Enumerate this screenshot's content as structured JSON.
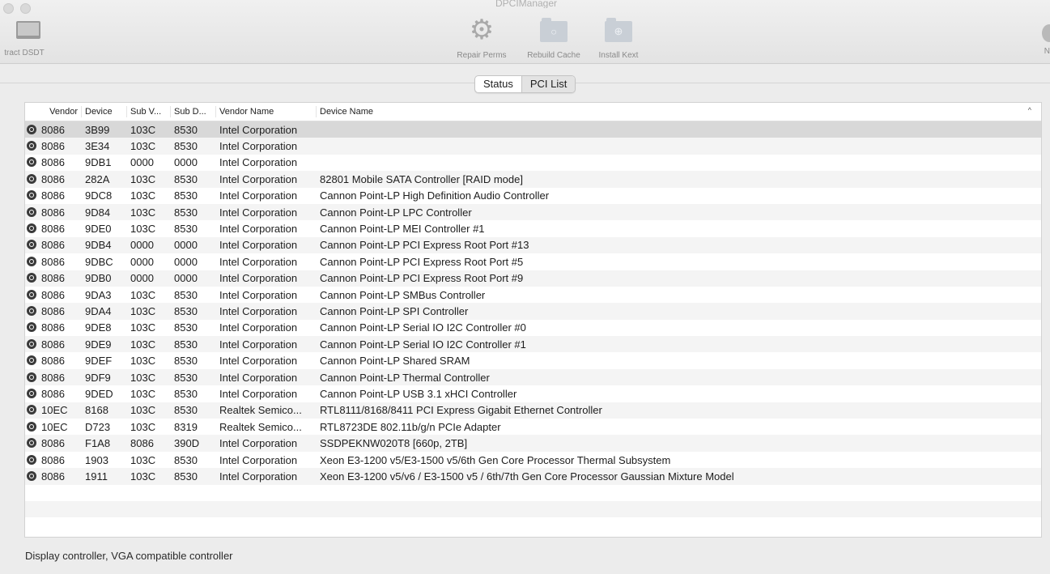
{
  "window": {
    "title": "DPCIManager"
  },
  "toolbar": {
    "extract_label": "tract DSDT",
    "repair_label": "Repair Perms",
    "rebuild_label": "Rebuild Cache",
    "install_label": "Install Kext",
    "edge_label": "N"
  },
  "tabs": {
    "status": "Status",
    "pci_list": "PCI List",
    "active": "PCI List"
  },
  "table": {
    "headers": {
      "vendor": "Vendor",
      "device": "Device",
      "sub_vendor": "Sub V...",
      "sub_device": "Sub D...",
      "vendor_name": "Vendor Name",
      "device_name": "Device Name"
    },
    "sort_indicator": "^",
    "selected_row": 0,
    "rows": [
      {
        "vendor": "8086",
        "device": "3B99",
        "sub_vendor": "103C",
        "sub_device": "8530",
        "vendor_name": "Intel Corporation",
        "device_name": ""
      },
      {
        "vendor": "8086",
        "device": "3E34",
        "sub_vendor": "103C",
        "sub_device": "8530",
        "vendor_name": "Intel Corporation",
        "device_name": ""
      },
      {
        "vendor": "8086",
        "device": "9DB1",
        "sub_vendor": "0000",
        "sub_device": "0000",
        "vendor_name": "Intel Corporation",
        "device_name": ""
      },
      {
        "vendor": "8086",
        "device": "282A",
        "sub_vendor": "103C",
        "sub_device": "8530",
        "vendor_name": "Intel Corporation",
        "device_name": "82801 Mobile SATA Controller [RAID mode]"
      },
      {
        "vendor": "8086",
        "device": "9DC8",
        "sub_vendor": "103C",
        "sub_device": "8530",
        "vendor_name": "Intel Corporation",
        "device_name": "Cannon Point-LP High Definition Audio Controller"
      },
      {
        "vendor": "8086",
        "device": "9D84",
        "sub_vendor": "103C",
        "sub_device": "8530",
        "vendor_name": "Intel Corporation",
        "device_name": "Cannon Point-LP LPC Controller"
      },
      {
        "vendor": "8086",
        "device": "9DE0",
        "sub_vendor": "103C",
        "sub_device": "8530",
        "vendor_name": "Intel Corporation",
        "device_name": "Cannon Point-LP MEI Controller #1"
      },
      {
        "vendor": "8086",
        "device": "9DB4",
        "sub_vendor": "0000",
        "sub_device": "0000",
        "vendor_name": "Intel Corporation",
        "device_name": "Cannon Point-LP PCI Express Root Port #13"
      },
      {
        "vendor": "8086",
        "device": "9DBC",
        "sub_vendor": "0000",
        "sub_device": "0000",
        "vendor_name": "Intel Corporation",
        "device_name": "Cannon Point-LP PCI Express Root Port #5"
      },
      {
        "vendor": "8086",
        "device": "9DB0",
        "sub_vendor": "0000",
        "sub_device": "0000",
        "vendor_name": "Intel Corporation",
        "device_name": "Cannon Point-LP PCI Express Root Port #9"
      },
      {
        "vendor": "8086",
        "device": "9DA3",
        "sub_vendor": "103C",
        "sub_device": "8530",
        "vendor_name": "Intel Corporation",
        "device_name": "Cannon Point-LP SMBus Controller"
      },
      {
        "vendor": "8086",
        "device": "9DA4",
        "sub_vendor": "103C",
        "sub_device": "8530",
        "vendor_name": "Intel Corporation",
        "device_name": "Cannon Point-LP SPI Controller"
      },
      {
        "vendor": "8086",
        "device": "9DE8",
        "sub_vendor": "103C",
        "sub_device": "8530",
        "vendor_name": "Intel Corporation",
        "device_name": "Cannon Point-LP Serial IO I2C Controller #0"
      },
      {
        "vendor": "8086",
        "device": "9DE9",
        "sub_vendor": "103C",
        "sub_device": "8530",
        "vendor_name": "Intel Corporation",
        "device_name": "Cannon Point-LP Serial IO I2C Controller #1"
      },
      {
        "vendor": "8086",
        "device": "9DEF",
        "sub_vendor": "103C",
        "sub_device": "8530",
        "vendor_name": "Intel Corporation",
        "device_name": "Cannon Point-LP Shared SRAM"
      },
      {
        "vendor": "8086",
        "device": "9DF9",
        "sub_vendor": "103C",
        "sub_device": "8530",
        "vendor_name": "Intel Corporation",
        "device_name": "Cannon Point-LP Thermal Controller"
      },
      {
        "vendor": "8086",
        "device": "9DED",
        "sub_vendor": "103C",
        "sub_device": "8530",
        "vendor_name": "Intel Corporation",
        "device_name": "Cannon Point-LP USB 3.1 xHCI Controller"
      },
      {
        "vendor": "10EC",
        "device": "8168",
        "sub_vendor": "103C",
        "sub_device": "8530",
        "vendor_name": "Realtek Semico...",
        "device_name": "RTL8111/8168/8411 PCI Express Gigabit Ethernet Controller"
      },
      {
        "vendor": "10EC",
        "device": "D723",
        "sub_vendor": "103C",
        "sub_device": "8319",
        "vendor_name": "Realtek Semico...",
        "device_name": "RTL8723DE 802.11b/g/n PCIe Adapter"
      },
      {
        "vendor": "8086",
        "device": "F1A8",
        "sub_vendor": "8086",
        "sub_device": "390D",
        "vendor_name": "Intel Corporation",
        "device_name": "SSDPEKNW020T8 [660p, 2TB]"
      },
      {
        "vendor": "8086",
        "device": "1903",
        "sub_vendor": "103C",
        "sub_device": "8530",
        "vendor_name": "Intel Corporation",
        "device_name": "Xeon E3-1200 v5/E3-1500 v5/6th Gen Core Processor Thermal Subsystem"
      },
      {
        "vendor": "8086",
        "device": "1911",
        "sub_vendor": "103C",
        "sub_device": "8530",
        "vendor_name": "Intel Corporation",
        "device_name": "Xeon E3-1200 v5/v6 / E3-1500 v5 / 6th/7th Gen Core Processor Gaussian Mixture Model"
      }
    ]
  },
  "status_bar": {
    "text": "Display controller, VGA compatible controller"
  }
}
